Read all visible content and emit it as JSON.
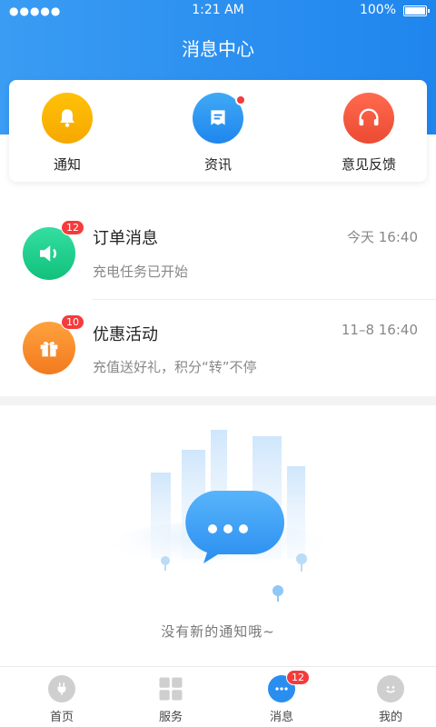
{
  "status_bar": {
    "signal": "●●●●●",
    "time": "1:21 AM",
    "battery": "100%"
  },
  "header": {
    "title": "消息中心"
  },
  "quick_actions": [
    {
      "label": "通知",
      "icon": "bell-icon",
      "color": "#f7b500"
    },
    {
      "label": "资讯",
      "icon": "news-icon",
      "color": "#2a8ef0"
    },
    {
      "label": "意见反馈",
      "icon": "headset-icon",
      "color": "#f0553d"
    }
  ],
  "messages": [
    {
      "title": "订单消息",
      "time": "今天 16:40",
      "preview": "充电任务已开始",
      "badge": "12",
      "icon": "speaker-icon",
      "color": "#1fcf8c"
    },
    {
      "title": "优惠活动",
      "time": "11–8 16:40",
      "preview": "充值送好礼，积分“转”不停",
      "badge": "10",
      "icon": "gift-icon",
      "color": "#f7862a"
    }
  ],
  "empty_state": {
    "text": "没有新的通知哦~"
  },
  "tabbar": [
    {
      "label": "首页",
      "icon": "plug-icon",
      "active": false
    },
    {
      "label": "服务",
      "icon": "grid-icon",
      "active": false
    },
    {
      "label": "消息",
      "icon": "chat-icon",
      "active": true,
      "badge": "12"
    },
    {
      "label": "我的",
      "icon": "smile-icon",
      "active": false
    }
  ],
  "colors": {
    "primary": "#2a8ef0",
    "badge": "#f53b3b",
    "inactive_icon": "#cfcfcf"
  }
}
